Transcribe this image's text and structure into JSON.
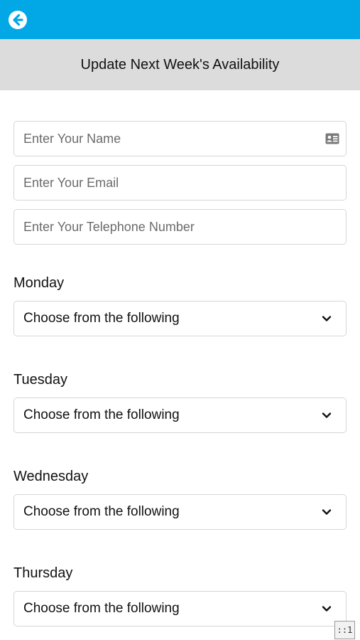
{
  "header": {
    "back_icon": "arrow-left-circle-icon",
    "accent_color": "#02a7e6",
    "title": "Update Next Week's Availability"
  },
  "form": {
    "name_placeholder": "Enter Your Name",
    "name_icon": "contact-card-icon",
    "email_placeholder": "Enter Your Email",
    "phone_placeholder": "Enter Your Telephone Number"
  },
  "days": [
    {
      "label": "Monday",
      "selected": "Choose from the following"
    },
    {
      "label": "Tuesday",
      "selected": "Choose from the following"
    },
    {
      "label": "Wednesday",
      "selected": "Choose from the following"
    },
    {
      "label": "Thursday",
      "selected": "Choose from the following"
    }
  ],
  "corner_badge": "::1"
}
